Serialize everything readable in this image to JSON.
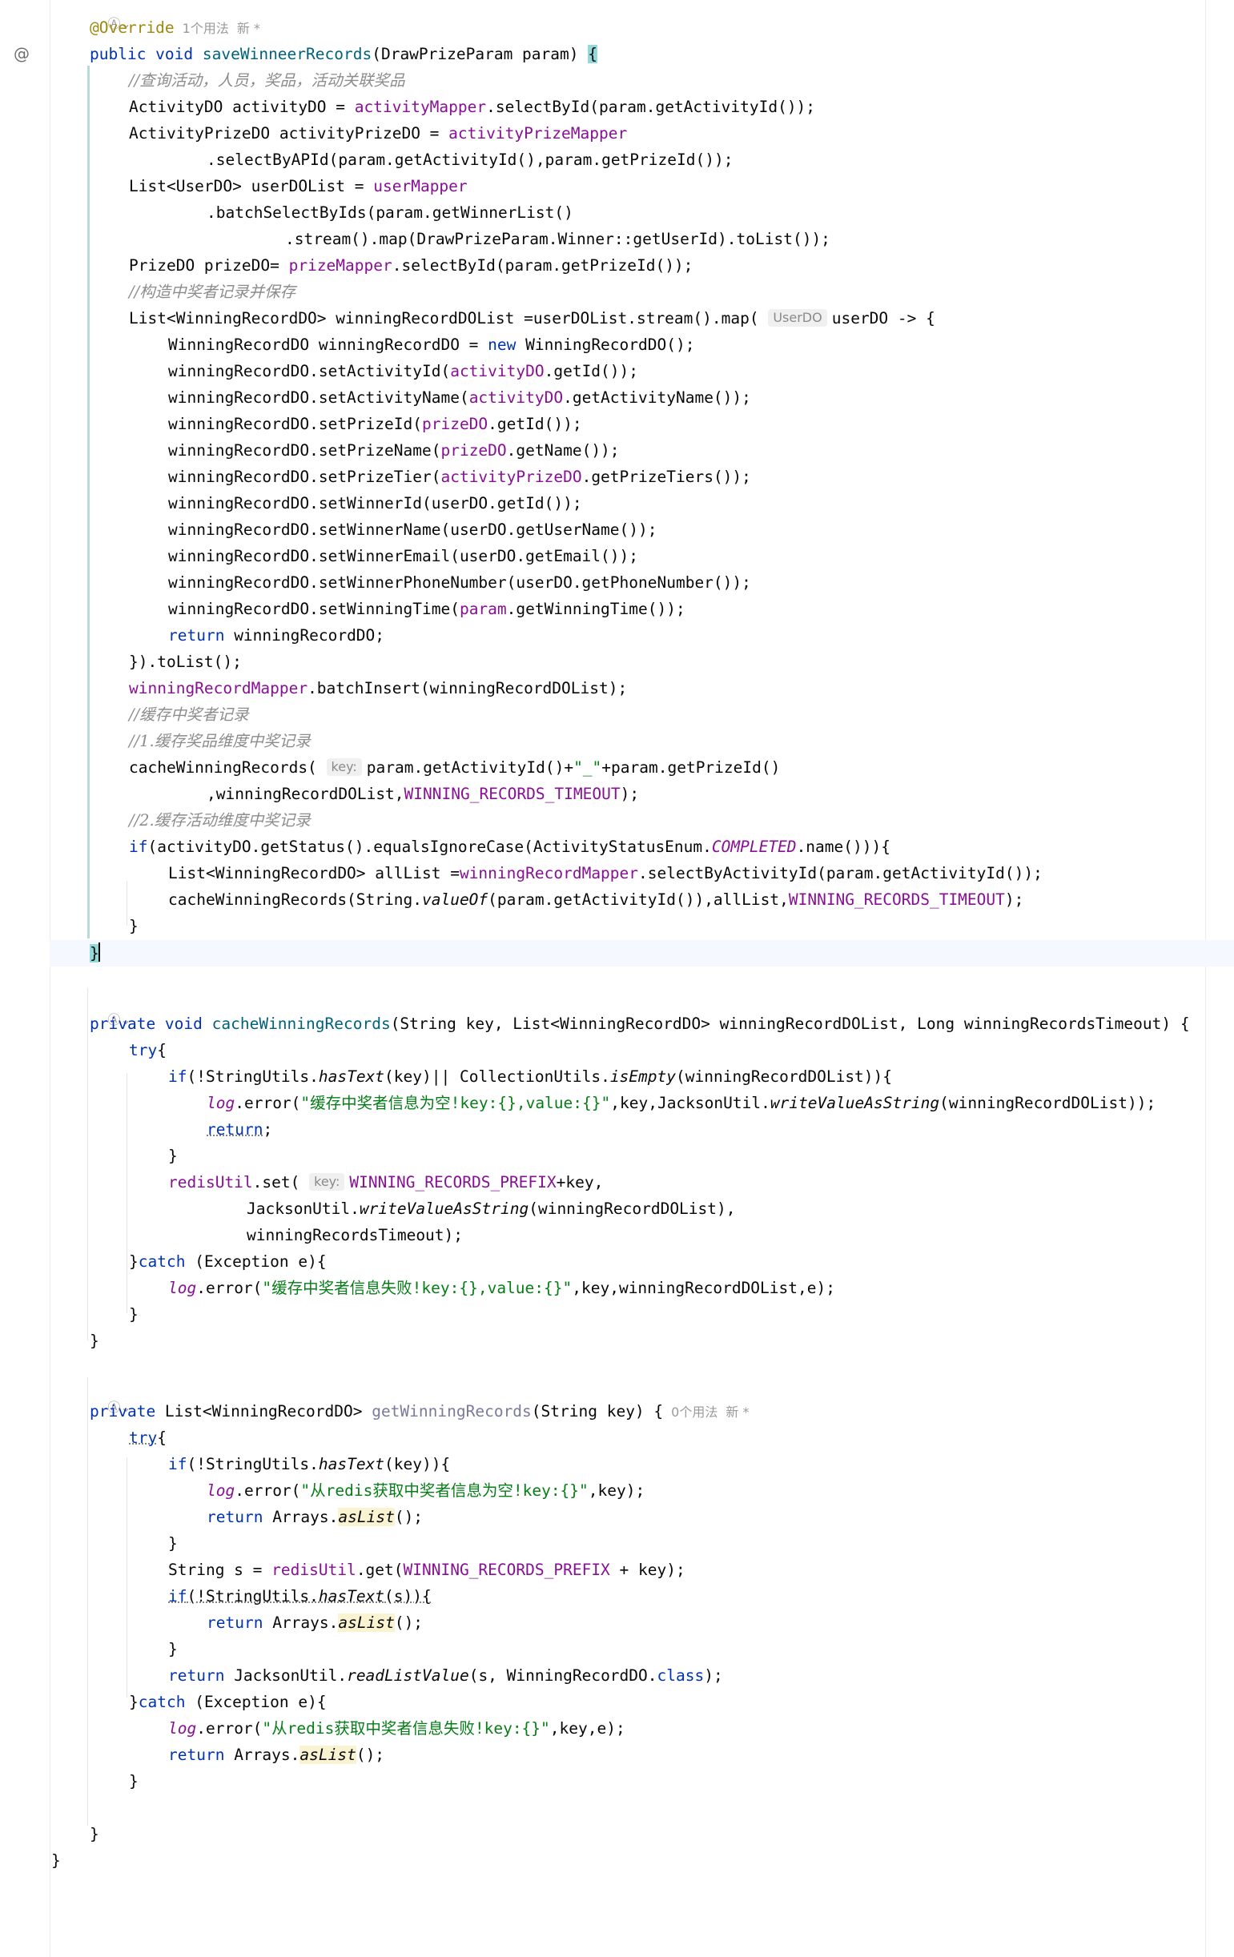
{
  "gutter": {
    "impl_icon": "@"
  },
  "meta": {
    "override_annotation": "@Override",
    "usage_1": "1个用法",
    "new_1": "新 *",
    "usage_0": "0个用法",
    "new_0": "新 *",
    "ai_icon": "Ⓐ",
    "chevron": "⌄"
  },
  "hints": {
    "userDO_type": "UserDO",
    "key": "key:"
  },
  "code": {
    "l1": "public void saveWinneerRecords(DrawPrizeParam param) {",
    "l2": "//查询活动，人员，奖品，活动关联奖品",
    "l3": "ActivityDO activityDO = activityMapper.selectById(param.getActivityId());",
    "l4": "ActivityPrizeDO activityPrizeDO = activityPrizeMapper",
    "l5": ".selectByAPId(param.getActivityId(),param.getPrizeId());",
    "l6": "List<UserDO> userDOList = userMapper",
    "l7": ".batchSelectByIds(param.getWinnerList()",
    "l8": ".stream().map(DrawPrizeParam.Winner::getUserId).toList());",
    "l9": "PrizeDO prizeDO= prizeMapper.selectById(param.getPrizeId());",
    "l10": "//构造中奖者记录并保存",
    "l11": "List<WinningRecordDO> winningRecordDOList =userDOList.stream().map( userDO -> {",
    "l12": "WinningRecordDO winningRecordDO = new WinningRecordDO();",
    "l13": "winningRecordDO.setActivityId(activityDO.getId());",
    "l14": "winningRecordDO.setActivityName(activityDO.getActivityName());",
    "l15": "winningRecordDO.setPrizeId(prizeDO.getId());",
    "l16": "winningRecordDO.setPrizeName(prizeDO.getName());",
    "l17": "winningRecordDO.setPrizeTier(activityPrizeDO.getPrizeTiers());",
    "l18": "winningRecordDO.setWinnerId(userDO.getId());",
    "l19": "winningRecordDO.setWinnerName(userDO.getUserName());",
    "l20": "winningRecordDO.setWinnerEmail(userDO.getEmail());",
    "l21": "winningRecordDO.setWinnerPhoneNumber(userDO.getPhoneNumber());",
    "l22": "winningRecordDO.setWinningTime(param.getWinningTime());",
    "l23": "return winningRecordDO;",
    "l24": "}).toList();",
    "l25": "winningRecordMapper.batchInsert(winningRecordDOList);",
    "l26": "//缓存中奖者记录",
    "l27": "//1.缓存奖品维度中奖记录",
    "l28": "cacheWinningRecords( param.getActivityId()+\"_\"+param.getPrizeId()",
    "l29": ",winningRecordDOList,WINNING_RECORDS_TIMEOUT);",
    "l30": "//2.缓存活动维度中奖记录",
    "l31": "if(activityDO.getStatus().equalsIgnoreCase(ActivityStatusEnum.COMPLETED.name())){",
    "l32": "List<WinningRecordDO> allList =winningRecordMapper.selectByActivityId(param.getActivityId());",
    "l33": "cacheWinningRecords(String.valueOf(param.getActivityId()),allList,WINNING_RECORDS_TIMEOUT);",
    "l34": "}",
    "l35": "}",
    "m1": "private void cacheWinningRecords(String key, List<WinningRecordDO> winningRecordDOList, Long winningRecordsTimeout) {",
    "m2": "try{",
    "m3": "if(!StringUtils.hasText(key)|| CollectionUtils.isEmpty(winningRecordDOList)){",
    "m4": "log.error(\"缓存中奖者信息为空!key:{},value:{}\",key,JacksonUtil.writeValueAsString(winningRecordDOList));",
    "m5": "return;",
    "m6": "}",
    "m7": "redisUtil.set( WINNING_RECORDS_PREFIX+key,",
    "m8": "JacksonUtil.writeValueAsString(winningRecordDOList),",
    "m9": "winningRecordsTimeout);",
    "m10": "}catch (Exception e){",
    "m11": "log.error(\"缓存中奖者信息失败!key:{},value:{}\",key,winningRecordDOList,e);",
    "m12": "}",
    "m13": "}",
    "g1": "private List<WinningRecordDO> getWinningRecords(String key) {",
    "g2": "try{",
    "g3": "if(!StringUtils.hasText(key)){",
    "g4": "log.error(\"从redis获取中奖者信息为空!key:{}\",key);",
    "g5": "return Arrays.asList();",
    "g6": "}",
    "g7": "String s = redisUtil.get(WINNING_RECORDS_PREFIX + key);",
    "g8": "if(!StringUtils.hasText(s)){",
    "g9": "return Arrays.asList();",
    "g10": "}",
    "g11": "return JacksonUtil.readListValue(s, WinningRecordDO.class);",
    "g12": "}catch (Exception e){",
    "g13": "log.error(\"从redis获取中奖者信息失败!key:{}\",key,e);",
    "g14": "return Arrays.asList();",
    "g15": "}",
    "g16": "}",
    "g17": "}"
  }
}
